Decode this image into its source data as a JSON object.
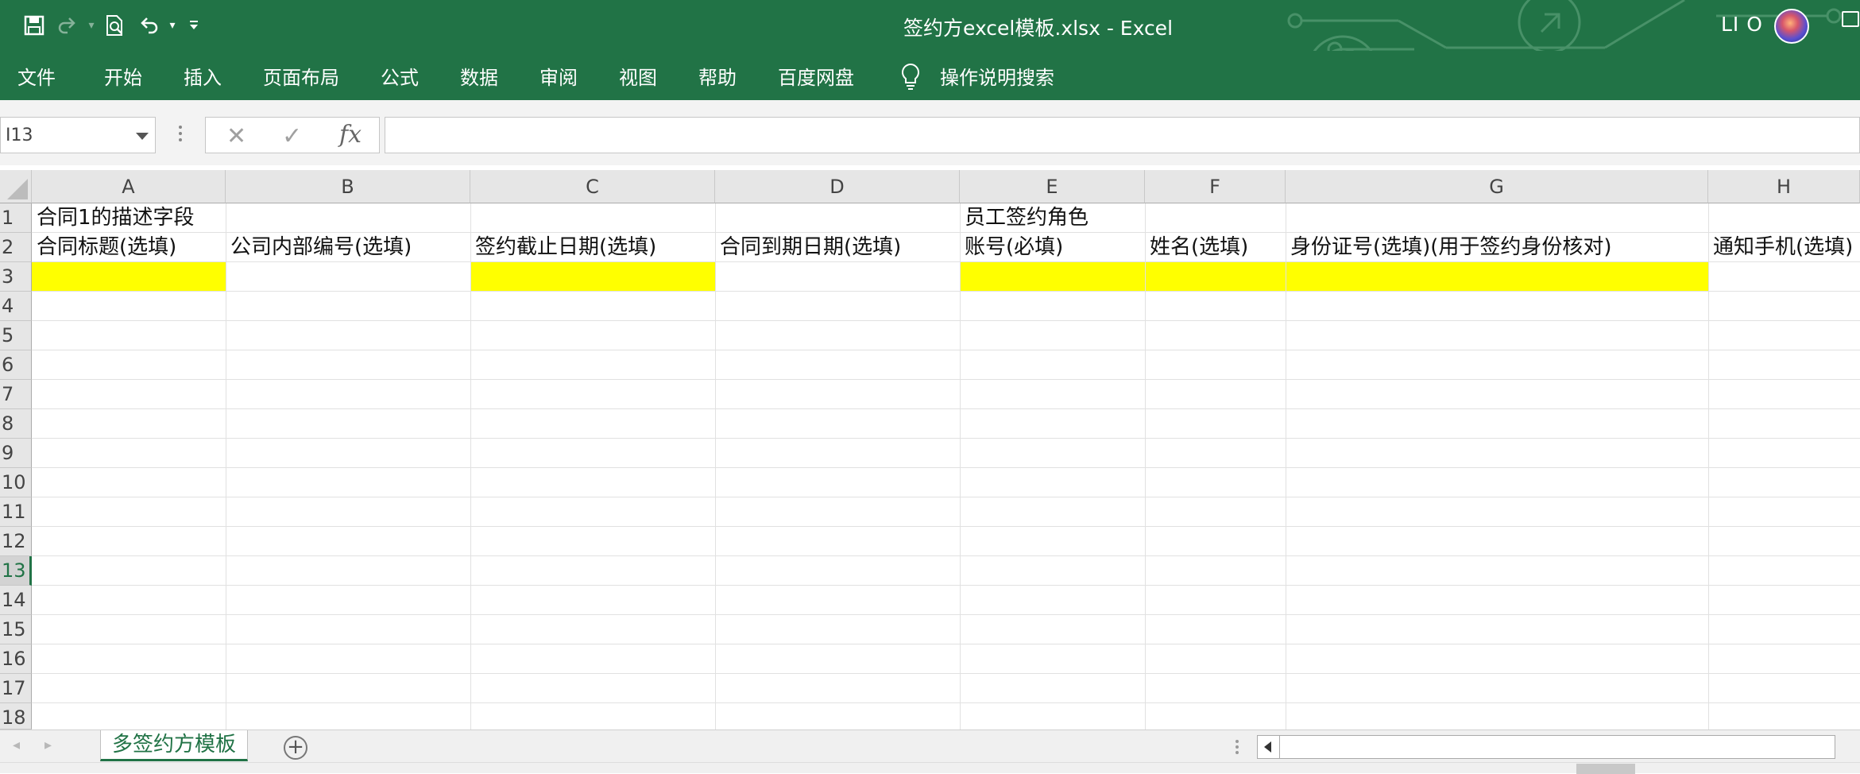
{
  "title_bar": {
    "title": "签约方excel模板.xlsx  -  Excel",
    "user": "LI O"
  },
  "quick_access": {
    "icons": [
      "save-icon",
      "redo-icon",
      "print-preview-icon",
      "undo-icon",
      "customize-icon"
    ]
  },
  "ribbon_tabs": [
    "文件",
    "开始",
    "插入",
    "页面布局",
    "公式",
    "数据",
    "审阅",
    "视图",
    "帮助",
    "百度网盘"
  ],
  "tell_me": "操作说明搜索",
  "formula_bar": {
    "name_box": "I13",
    "formula": "",
    "fx_label": "fx"
  },
  "columns": [
    "A",
    "B",
    "C",
    "D",
    "E",
    "F",
    "G",
    "H"
  ],
  "rows": [
    "1",
    "2",
    "3",
    "4",
    "5",
    "6",
    "7",
    "8",
    "9",
    "10",
    "11",
    "12",
    "13",
    "14",
    "15",
    "16",
    "17",
    "18"
  ],
  "selected_row": "13",
  "cells": {
    "A1": "合同1的描述字段",
    "E1": "员工签约角色",
    "A2": "合同标题(选填)",
    "B2": "公司内部编号(选填)",
    "C2": "签约截止日期(选填)",
    "D2": "合同到期日期(选填)",
    "E2": "账号(必填)",
    "F2": "姓名(选填)",
    "G2": "身份证号(选填)(用于签约身份核对)",
    "H2": "通知手机(选填)"
  },
  "highlight_color": "#ffff00",
  "accent_color": "#217346",
  "sheet_tabs": [
    "多签约方模板"
  ]
}
